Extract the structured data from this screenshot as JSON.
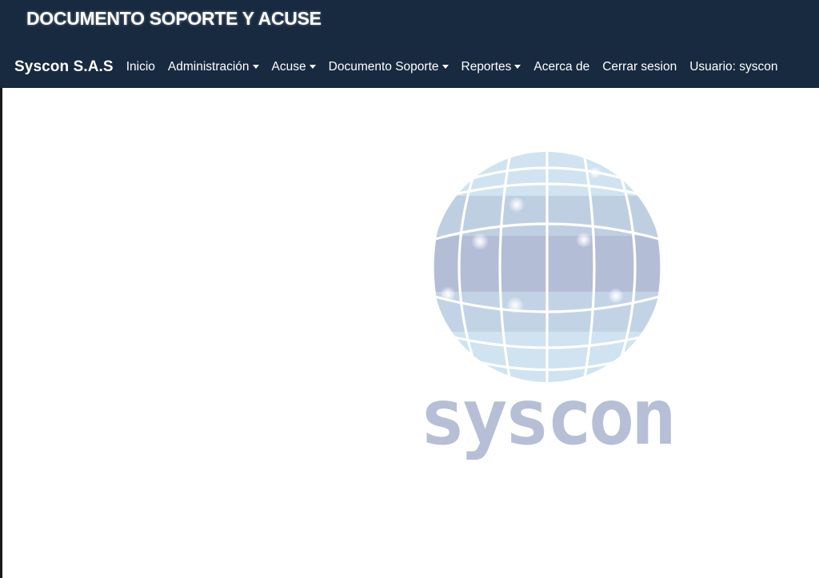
{
  "app": {
    "title": "DOCUMENTO SOPORTE Y ACUSE"
  },
  "navbar": {
    "brand": "Syscon S.A.S",
    "items": [
      {
        "label": "Inicio",
        "dropdown": false
      },
      {
        "label": "Administración",
        "dropdown": true
      },
      {
        "label": "Acuse",
        "dropdown": true
      },
      {
        "label": "Documento Soporte",
        "dropdown": true
      },
      {
        "label": "Reportes",
        "dropdown": true
      },
      {
        "label": "Acerca de",
        "dropdown": false
      },
      {
        "label": "Cerrar sesion",
        "dropdown": false
      },
      {
        "label": "Usuario: syscon",
        "dropdown": false
      }
    ]
  },
  "logo": {
    "text": "syscon",
    "icon": "globe-icon"
  },
  "colors": {
    "header_bg": "#172a40",
    "logo_text": "#b6bfd6",
    "globe_light": "#cfe3f0",
    "globe_mid": "#bccbde",
    "globe_dark": "#b0b9d2"
  }
}
